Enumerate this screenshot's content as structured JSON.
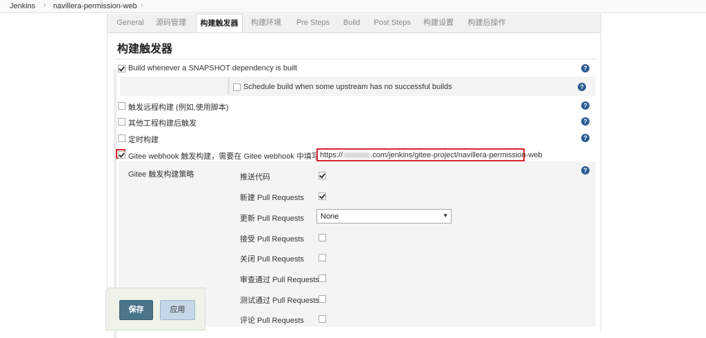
{
  "breadcrumb": {
    "items": [
      "Jenkins",
      "navillera-permission-web"
    ],
    "separator": "›"
  },
  "tabs": [
    {
      "label": "General",
      "active": false
    },
    {
      "label": "源码管理",
      "active": false
    },
    {
      "label": "构建触发器",
      "active": true
    },
    {
      "label": "构建环境",
      "active": false
    },
    {
      "label": "Pre Steps",
      "active": false
    },
    {
      "label": "Build",
      "active": false
    },
    {
      "label": "Post Steps",
      "active": false
    },
    {
      "label": "构建设置",
      "active": false
    },
    {
      "label": "构建后操作",
      "active": false
    }
  ],
  "section": {
    "title": "构建触发器"
  },
  "triggers": [
    {
      "label": "Build whenever a SNAPSHOT dependency is built",
      "checked": true
    },
    {
      "label": "Schedule build when some upstream has no successful builds",
      "checked": false
    },
    {
      "label": "触发远程构建 (例如,使用脚本)",
      "checked": false
    },
    {
      "label": "其他工程构建后触发",
      "checked": false
    },
    {
      "label": "定时构建",
      "checked": false
    },
    {
      "label": "Gitee webhook 触发构建，需要在 Gitee webhook 中填写 URL:",
      "checked": true
    }
  ],
  "webhook_url": {
    "prefix": "https://",
    "suffix": ".com/jenkins/gitee-project/navillera-permission-web"
  },
  "strategy": {
    "label": "Gitee 触发构建策略",
    "options": [
      {
        "label": "推送代码",
        "checked": true
      },
      {
        "label": "新建 Pull Requests",
        "checked": true
      },
      {
        "label": "更新 Pull Requests",
        "select": "None"
      },
      {
        "label": "接受 Pull Requests",
        "checked": false
      },
      {
        "label": "关闭 Pull Requests",
        "checked": false
      },
      {
        "label": "审查通过 Pull Requests",
        "checked": false
      },
      {
        "label": "测试通过 Pull Requests",
        "checked": false
      },
      {
        "label": "评论 Pull Requests",
        "checked": false
      }
    ]
  },
  "help_glyph": "?",
  "select_arrow": "▼",
  "buttons": {
    "save": "保存",
    "apply": "应用"
  },
  "colors": {
    "highlight": "#d9232c",
    "help": "#2b5b93",
    "save": "#4b758b",
    "apply": "#c6d7e8"
  }
}
